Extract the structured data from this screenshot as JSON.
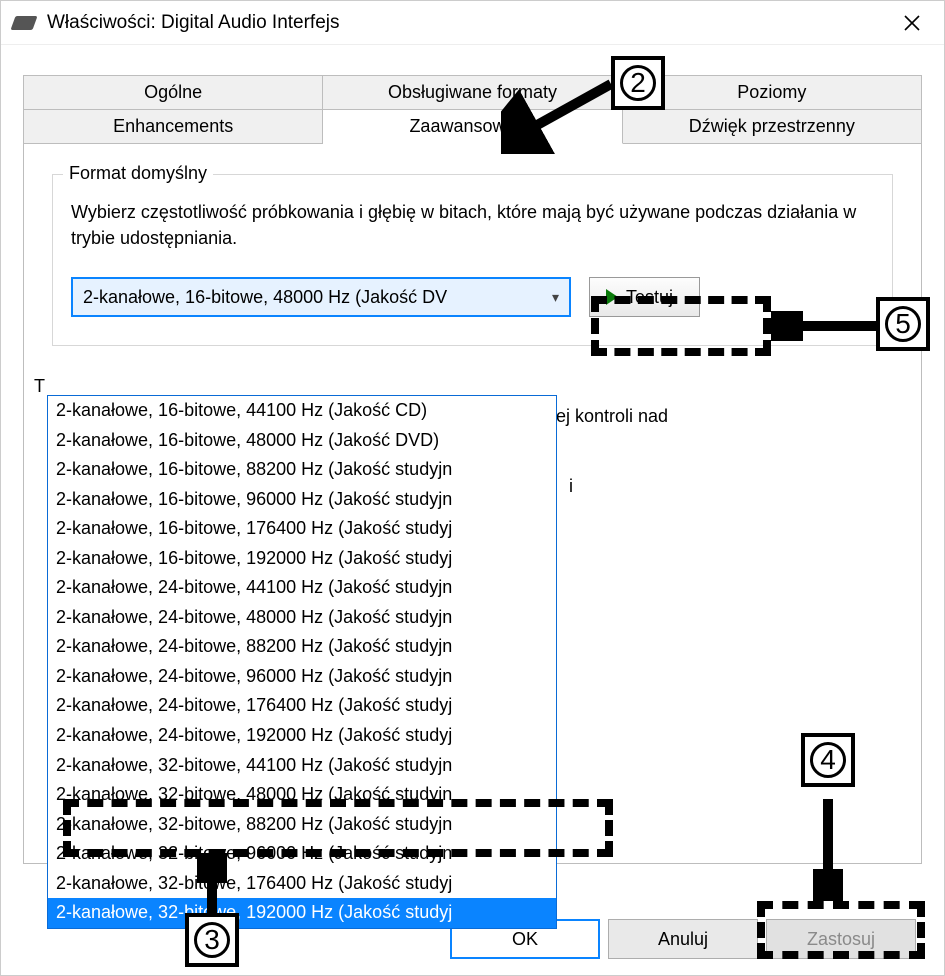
{
  "window": {
    "title": "Właściwości: Digital Audio Interfejs"
  },
  "tabs_row1": [
    "Ogólne",
    "Obsługiwane formaty",
    "Poziomy"
  ],
  "tabs_row2": [
    "Enhancements",
    "Zaawansowane",
    "Dźwięk przestrzenny"
  ],
  "active_tab": "Zaawansowane",
  "group": {
    "legend": "Format domyślny",
    "desc": "Wybierz częstotliwość próbkowania i głębię w bitach, które mają być używane podczas działania w trybie udostępniania."
  },
  "combo": {
    "selected": "2-kanałowe, 16-bitowe, 48000 Hz (Jakość DV"
  },
  "test_button": "Testuj",
  "hidden_group_prefix": "T",
  "hidden_text_right1": "ej kontroli nad",
  "hidden_text_right2": "i",
  "dropdown_options": [
    "2-kanałowe, 16-bitowe, 44100 Hz (Jakość CD)",
    "2-kanałowe, 16-bitowe, 48000 Hz (Jakość DVD)",
    "2-kanałowe, 16-bitowe, 88200 Hz (Jakość studyjn",
    "2-kanałowe, 16-bitowe, 96000 Hz (Jakość studyjn",
    "2-kanałowe, 16-bitowe, 176400 Hz (Jakość studyj",
    "2-kanałowe, 16-bitowe, 192000 Hz (Jakość studyj",
    "2-kanałowe, 24-bitowe, 44100 Hz (Jakość studyjn",
    "2-kanałowe, 24-bitowe, 48000 Hz (Jakość studyjn",
    "2-kanałowe, 24-bitowe, 88200 Hz (Jakość studyjn",
    "2-kanałowe, 24-bitowe, 96000 Hz (Jakość studyjn",
    "2-kanałowe, 24-bitowe, 176400 Hz (Jakość studyj",
    "2-kanałowe, 24-bitowe, 192000 Hz (Jakość studyj",
    "2-kanałowe, 32-bitowe, 44100 Hz (Jakość studyjn",
    "2-kanałowe, 32-bitowe, 48000 Hz (Jakość studyjn",
    "2-kanałowe, 32-bitowe, 88200 Hz (Jakość studyjn",
    "2-kanałowe, 32-bitowe, 96000 Hz (Jakość studyjn",
    "2-kanałowe, 32-bitowe, 176400 Hz (Jakość studyj",
    "2-kanałowe, 32-bitowe, 192000 Hz (Jakość studyj"
  ],
  "dropdown_selected_index": 17,
  "footer": {
    "ok": "OK",
    "cancel": "Anuluj",
    "apply": "Zastosuj"
  },
  "annotations": {
    "n2": "2",
    "n3": "3",
    "n4": "4",
    "n5": "5"
  }
}
